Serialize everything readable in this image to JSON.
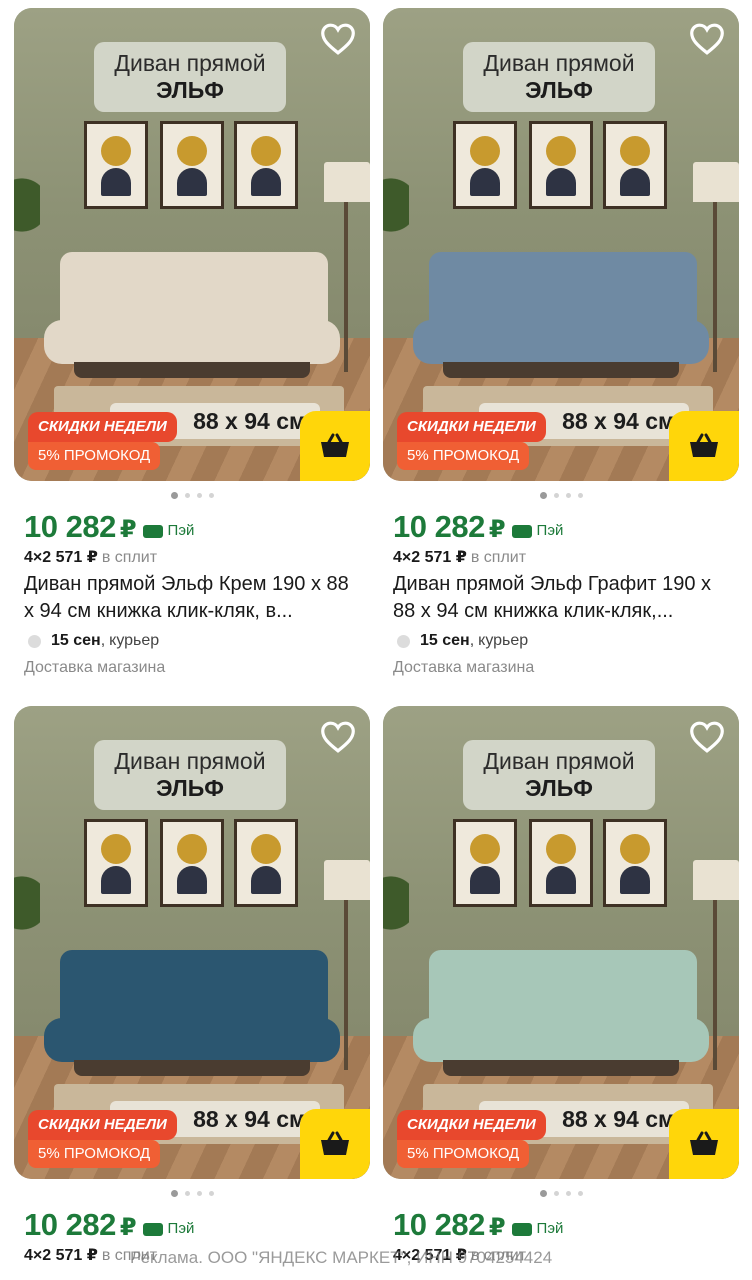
{
  "common": {
    "plaque_line1": "Диван прямой",
    "plaque_line2": "ЭЛЬФ",
    "dims_text": "88 x 94 см",
    "badge_week": "СКИДКИ НЕДЕЛИ",
    "badge_promo": "5% ПРОМОКОД",
    "price": "10 282",
    "currency": "₽",
    "pay_label": "Пэй",
    "split_amount": "4×2 571 ₽",
    "split_suffix": "в сплит",
    "favorite_icon": "heart-outline-icon",
    "cart_icon": "basket-icon"
  },
  "products": [
    {
      "name": "Диван прямой Эльф Крем 190 x 88 x 94 см книжка клик-кляк, в...",
      "sofa_color": "#e2d8c8",
      "delivery_date": "15 сен",
      "delivery_sep": ",",
      "delivery_mode": "курьер",
      "seller": "Доставка магазина"
    },
    {
      "name": "Диван прямой Эльф Графит 190 x 88 x 94 см книжка клик-кляк,...",
      "sofa_color": "#6f8aa3",
      "delivery_date": "15 сен",
      "delivery_sep": ",",
      "delivery_mode": "курьер",
      "seller": "Доставка магазина"
    },
    {
      "name": "",
      "sofa_color": "#2b5670",
      "delivery_date": "",
      "delivery_sep": "",
      "delivery_mode": "",
      "seller": ""
    },
    {
      "name": "",
      "sofa_color": "#a7c7b8",
      "delivery_date": "",
      "delivery_sep": "",
      "delivery_mode": "",
      "seller": ""
    }
  ],
  "ad_notice": "Реклама. ООО \"ЯНДЕКС МАРКЕТ\", ИНН 9704254424",
  "colors": {
    "price_green": "#1d7a3a",
    "cart_yellow": "#ffd60a",
    "badge_red": "#e8482d"
  }
}
